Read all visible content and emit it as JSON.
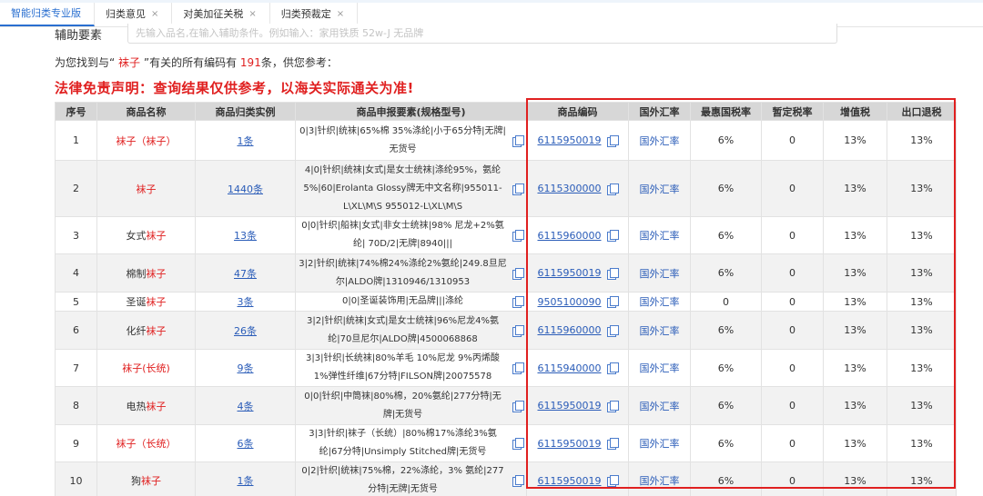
{
  "tabs": [
    {
      "label": "智能归类专业版",
      "close": "",
      "active": true
    },
    {
      "label": "归类意见",
      "close": "×",
      "active": false
    },
    {
      "label": "对美加征关税",
      "close": "×",
      "active": false
    },
    {
      "label": "归类预裁定",
      "close": "×",
      "active": false
    }
  ],
  "aux": {
    "label": "辅助要素",
    "placeholder": "先输入品名,在输入辅助条件。例如输入：家用铁质 52w-J 无品牌"
  },
  "found": {
    "prefix": "为您找到与“ ",
    "keyword": "袜子",
    "middle": " ”有关的所有编码有 ",
    "count": "191",
    "suffix": "条，供您参考："
  },
  "disclaimer": "法律免责声明：查询结果仅供参考，以海关实际通关为准!",
  "table": {
    "headers": [
      "序号",
      "商品名称",
      "商品归类实例",
      "商品申报要素(规格型号)",
      "商品编码",
      "国外汇率",
      "最惠国税率",
      "暂定税率",
      "增值税",
      "出口退税"
    ],
    "rows": [
      {
        "no": "1",
        "name_pre": "",
        "name_red": "袜子（袜子）",
        "name_post": "",
        "example": "1条",
        "spec": "0|3|针织|统袜|65%棉 35%涤纶|小于65分特|无牌|无货号",
        "code": "6115950019",
        "rate": "国外汇率",
        "mfn": "6%",
        "temp": "0",
        "vat": "13%",
        "refund": "13%",
        "h": 44
      },
      {
        "no": "2",
        "name_pre": "",
        "name_red": "袜子",
        "name_post": "",
        "example": "1440条",
        "spec": "4|0|针织|统袜|女式|是女士统袜|涤纶95%，氨纶5%|60|Erolanta Glossy牌无中文名称|955011-L\\XL\\M\\S 955012-L\\XL\\M\\S",
        "code": "6115300000",
        "rate": "国外汇率",
        "mfn": "6%",
        "temp": "0",
        "vat": "13%",
        "refund": "13%",
        "h": 62
      },
      {
        "no": "3",
        "name_pre": "女式",
        "name_red": "袜子",
        "name_post": "",
        "example": "13条",
        "spec": "0|0|针织|船袜|女式|非女士统袜|98% 尼龙+2%氨纶| 70D/2|无牌|8940|||",
        "code": "6115960000",
        "rate": "国外汇率",
        "mfn": "6%",
        "temp": "0",
        "vat": "13%",
        "refund": "13%",
        "h": 40
      },
      {
        "no": "4",
        "name_pre": "棉制",
        "name_red": "袜子",
        "name_post": "",
        "example": "47条",
        "spec": "3|2|针织|统袜|74%棉24%涤纶2%氨纶|249.8旦尼尔|ALDO牌|1310946/1310953",
        "code": "6115950019",
        "rate": "国外汇率",
        "mfn": "6%",
        "temp": "0",
        "vat": "13%",
        "refund": "13%",
        "h": 42
      },
      {
        "no": "5",
        "name_pre": "圣诞",
        "name_red": "袜子",
        "name_post": "",
        "example": "3条",
        "spec": "0|0|圣诞装饰用|无品牌|||涤纶",
        "code": "9505100090",
        "rate": "国外汇率",
        "mfn": "0",
        "temp": "0",
        "vat": "13%",
        "refund": "13%",
        "h": 20
      },
      {
        "no": "6",
        "name_pre": "化纤",
        "name_red": "袜子",
        "name_post": "",
        "example": "26条",
        "spec": "3|2|针织|统袜|女式|是女士统袜|96%尼龙4%氨纶|70旦尼尔|ALDO牌|4500068868",
        "code": "6115960000",
        "rate": "国外汇率",
        "mfn": "6%",
        "temp": "0",
        "vat": "13%",
        "refund": "13%",
        "h": 42
      },
      {
        "no": "7",
        "name_pre": "",
        "name_red": "袜子",
        "name_post": "(长统)",
        "example": "9条",
        "spec": "3|3|针织|长统袜|80%羊毛 10%尼龙 9%丙烯酸 1%弹性纤维|67分特|FILSON牌|20075578",
        "code": "6115940000",
        "rate": "国外汇率",
        "mfn": "6%",
        "temp": "0",
        "vat": "13%",
        "refund": "13%",
        "h": 40
      },
      {
        "no": "8",
        "name_pre": "电热",
        "name_red": "袜子",
        "name_post": "",
        "example": "4条",
        "spec": "0|0|针织|中筒袜|80%棉，20%氨纶|277分特|无牌|无货号",
        "code": "6115950019",
        "rate": "国外汇率",
        "mfn": "6%",
        "temp": "0",
        "vat": "13%",
        "refund": "13%",
        "h": 42
      },
      {
        "no": "9",
        "name_pre": "",
        "name_red": "袜子",
        "name_post": "（长统）",
        "example": "6条",
        "spec": "3|3|针织|袜子（长统）|80%棉17%涤纶3%氨纶|67分特|Unsimply Stitched牌|无货号",
        "code": "6115950019",
        "rate": "国外汇率",
        "mfn": "6%",
        "temp": "0",
        "vat": "13%",
        "refund": "13%",
        "h": 40
      },
      {
        "no": "10",
        "name_pre": "狗",
        "name_red": "袜子",
        "name_post": "",
        "example": "1条",
        "spec": "0|2|针织|统袜|75%棉，22%涤纶，3% 氨纶|277分特|无牌|无货号",
        "code": "6115950019",
        "rate": "国外汇率",
        "mfn": "6%",
        "temp": "0",
        "vat": "13%",
        "refund": "13%",
        "h": 40
      }
    ]
  },
  "colors": {
    "accent": "#2a6fd0",
    "red": "#e02020",
    "link": "#2a5cb8",
    "header_bg": "#d7d7d7"
  }
}
